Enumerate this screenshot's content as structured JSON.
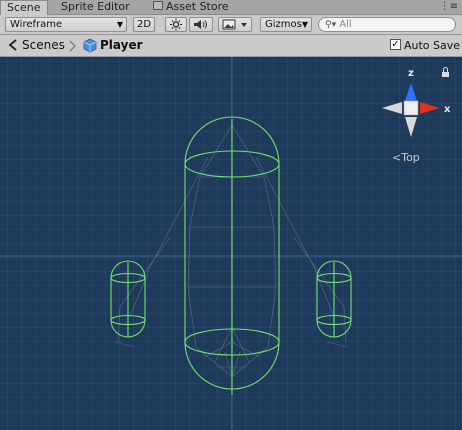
{
  "tabs": [
    {
      "label": "Scene",
      "active": true
    },
    {
      "label": "Sprite Editor",
      "active": false
    },
    {
      "label": "Asset Store",
      "active": false
    }
  ],
  "toolbar": {
    "render_mode": "Wireframe",
    "mode_2d": "2D",
    "gizmos": "Gizmos",
    "search_placeholder": "All"
  },
  "breadcrumb": {
    "scenes": "Scenes",
    "prefab": "Player"
  },
  "auto_save": {
    "label": "Auto Save",
    "checked": true
  },
  "gizmo": {
    "view_label": "Top",
    "axis_z": "z",
    "axis_x": "x"
  },
  "colors": {
    "scene_bg": "#1e3a5a",
    "wire": "#7fe06f",
    "axis_x": "#e0301e",
    "axis_z": "#3070ff"
  },
  "icons": [
    "lock-icon",
    "menu-icon",
    "sun-icon",
    "speaker-icon",
    "image-icon",
    "search-icon",
    "scene-icon",
    "prefab-icon"
  ]
}
